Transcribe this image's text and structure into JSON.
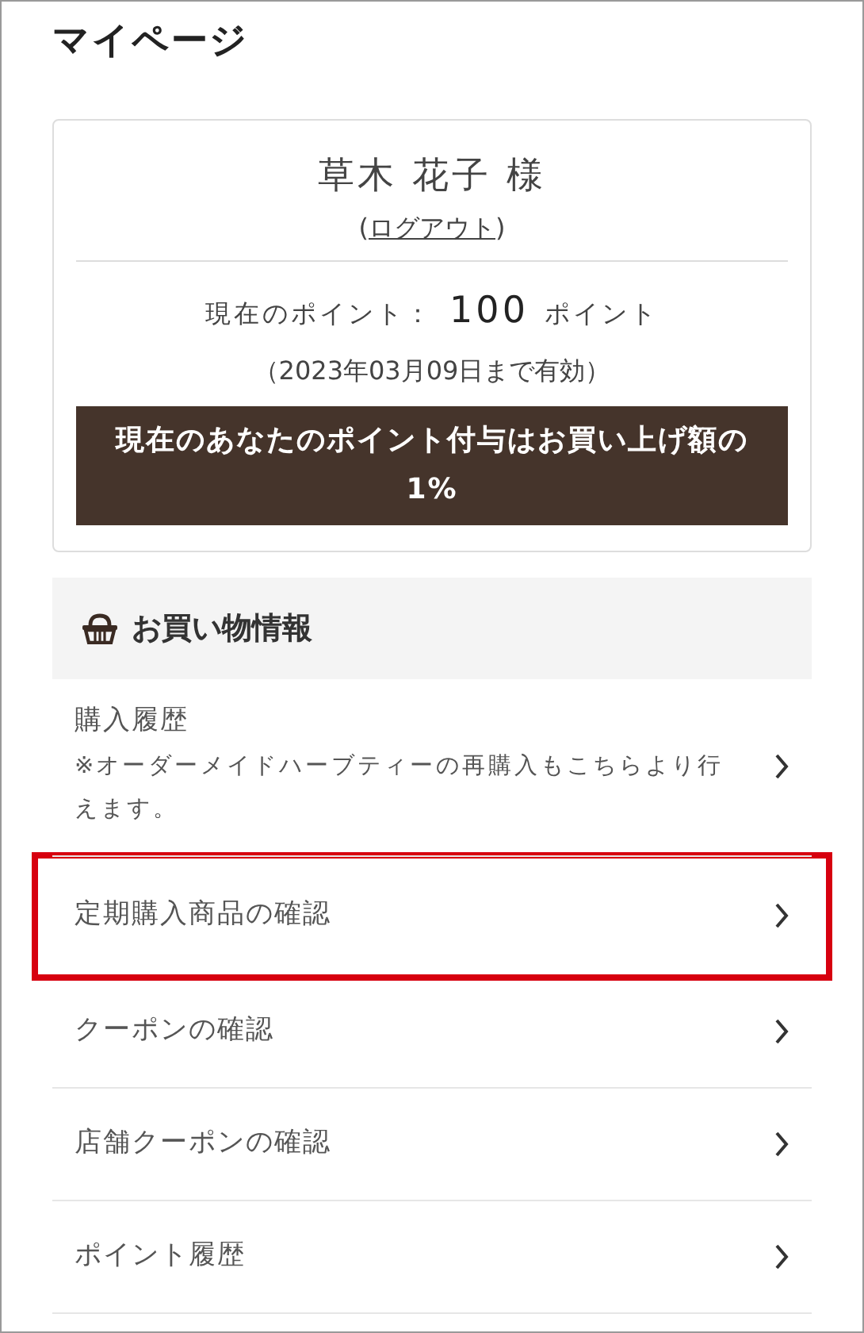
{
  "page_title": "マイページ",
  "account": {
    "name": "草木 花子 様",
    "logout_open": "(",
    "logout_link": "ログアウト",
    "logout_close": ")",
    "points_label": "現在のポイント：",
    "points_value": "100",
    "points_unit": "ポイント",
    "expiry": "（2023年03月09日まで有効）",
    "notice": "現在のあなたのポイント付与はお買い上げ額の1%"
  },
  "section": {
    "title": "お買い物情報"
  },
  "menu_items": [
    {
      "label": "購入履歴",
      "note": "※オーダーメイドハーブティーの再購入もこちらより行えます。",
      "highlighted": false
    },
    {
      "label": "定期購入商品の確認",
      "highlighted": true
    },
    {
      "label": "クーポンの確認",
      "highlighted": false
    },
    {
      "label": "店舗クーポンの確認",
      "highlighted": false
    },
    {
      "label": "ポイント履歴",
      "highlighted": false
    }
  ]
}
